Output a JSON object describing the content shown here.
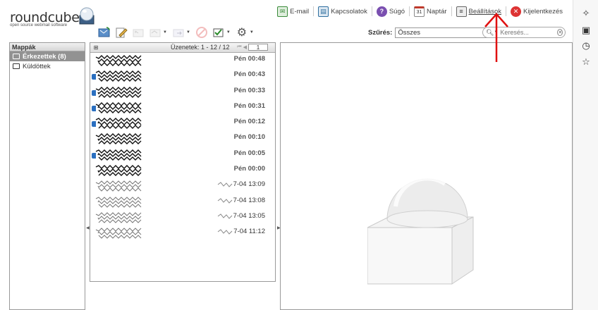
{
  "app": {
    "logo_text": "roundcube",
    "logo_tagline": "open source webmail software"
  },
  "topnav": [
    {
      "id": "email",
      "label": "E-mail",
      "icon": "mail-icon",
      "color": "#3b8b3b"
    },
    {
      "id": "contacts",
      "label": "Kapcsolatok",
      "icon": "address-book-icon",
      "color": "#2f6f9f"
    },
    {
      "id": "help",
      "label": "Súgó",
      "icon": "help-icon",
      "color": "#6a3fa0"
    },
    {
      "id": "calendar",
      "label": "Naptár",
      "icon": "calendar-icon",
      "color": "#c0392b"
    },
    {
      "id": "settings",
      "label": "Beállítások",
      "icon": "settings-icon",
      "color": "#555555"
    },
    {
      "id": "logout",
      "label": "Kijelentkezés",
      "icon": "logout-icon",
      "color": "#d33"
    }
  ],
  "filter": {
    "label": "Szűrés:",
    "value": "Összes"
  },
  "search": {
    "placeholder": "Keresés..."
  },
  "folders": {
    "title": "Mappák",
    "items": [
      {
        "label": "Érkezettek (8)",
        "selected": true
      },
      {
        "label": "Küldöttek",
        "selected": false
      }
    ]
  },
  "messagelist": {
    "count_label": "Üzenetek: 1 - 12 / 12",
    "page": "1",
    "messages": [
      {
        "time": "Pén 00:48",
        "unread": true
      },
      {
        "time": "Pén 00:43",
        "unread": true
      },
      {
        "time": "Pén 00:33",
        "unread": true
      },
      {
        "time": "Pén 00:31",
        "unread": true
      },
      {
        "time": "Pén 00:12",
        "unread": true
      },
      {
        "time": "Pén 00:10",
        "unread": true
      },
      {
        "time": "Pén 00:05",
        "unread": true
      },
      {
        "time": "Pén 00:00",
        "unread": true
      },
      {
        "time": "7-04 13:09",
        "unread": false
      },
      {
        "time": "7-04 13:08",
        "unread": false
      },
      {
        "time": "7-04 13:05",
        "unread": false
      },
      {
        "time": "7-04 11:12",
        "unread": false
      }
    ]
  },
  "colors": {
    "annotation_arrow": "#e01010",
    "selected_folder": "#929292"
  }
}
